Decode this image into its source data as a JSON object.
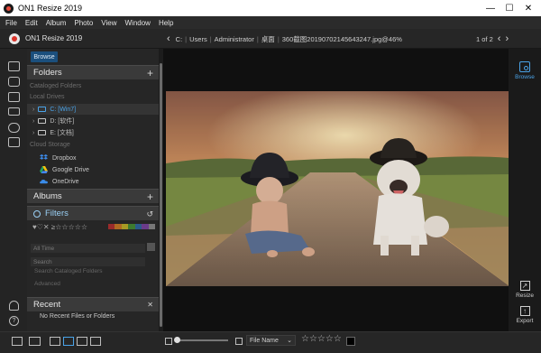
{
  "window": {
    "title": "ON1 Resize 2019",
    "controls": [
      "—",
      "☐",
      "✕"
    ]
  },
  "menu": [
    "File",
    "Edit",
    "Album",
    "Photo",
    "View",
    "Window",
    "Help"
  ],
  "topbar": {
    "app_name": "ON1 Resize 2019",
    "path": [
      "C:",
      "Users",
      "Administrator",
      "桌面",
      "360截图20190702145643247.jpg@46%"
    ],
    "pager": "1 of 2"
  },
  "sidebar": {
    "browse_tab": "Browse",
    "folders": {
      "title": "Folders",
      "cataloged_label": "Cataloged Folders",
      "local_label": "Local Drives",
      "drives": [
        {
          "label": "C: [Win7]",
          "selected": true
        },
        {
          "label": "D: [软件]",
          "selected": false
        },
        {
          "label": "E: [文档]",
          "selected": false
        }
      ],
      "cloud_label": "Cloud Storage",
      "cloud": [
        "Dropbox",
        "Google Drive",
        "OneDrive"
      ]
    },
    "albums": {
      "title": "Albums"
    },
    "filters": {
      "title": "Filters",
      "symbols": "♥♡✕ ≥☆☆☆☆☆",
      "swatch_colors": [
        "#9a2b2b",
        "#b06a22",
        "#a89a24",
        "#3d7a2e",
        "#2b5a8a",
        "#6a3b8a",
        "#777777"
      ],
      "time_placeholder": "All Time",
      "search_placeholder": "Search",
      "search_cataloged": "Search Cataloged Folders",
      "advanced": "Advanced"
    },
    "recent": {
      "title": "Recent",
      "empty_text": "No Recent Files or Folders"
    }
  },
  "rightrail": {
    "browse": "Browse",
    "resize": "Resize",
    "export": "Export"
  },
  "bottombar": {
    "sort_label": "File Name",
    "stars": "☆☆☆☆☆"
  },
  "colors": {
    "accent": "#4aa3e8",
    "selected_tab": "#1b4f7d",
    "panel": "#262626"
  }
}
